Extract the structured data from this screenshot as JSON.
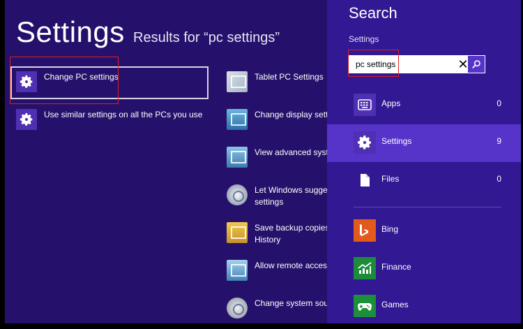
{
  "left": {
    "title": "Settings",
    "results_for": "Results for “pc settings”",
    "settings_results": [
      {
        "label": "Change PC settings",
        "icon": "gear-icon"
      },
      {
        "label": "Use similar settings on all the PCs you use",
        "icon": "gear-icon"
      }
    ],
    "control_panel_results": [
      {
        "label": "Tablet PC Settings",
        "icon": "tablet-pc-icon"
      },
      {
        "label": "Change display sett",
        "icon": "display-icon"
      },
      {
        "label": "View advanced syste",
        "icon": "advanced-system-icon"
      },
      {
        "label": "Let Windows sugge",
        "label2": "settings",
        "icon": "ease-of-access-icon"
      },
      {
        "label": "Save backup copies",
        "label2": "History",
        "icon": "file-history-icon"
      },
      {
        "label": "Allow remote access",
        "icon": "remote-access-icon"
      },
      {
        "label": "Change system sour",
        "icon": "sound-icon"
      }
    ]
  },
  "search_pane": {
    "title": "Search",
    "scope": "Settings",
    "query": "pc settings",
    "clear_glyph": "✕",
    "categories": [
      {
        "name": "Apps",
        "count": "0",
        "icon": "apps-icon"
      },
      {
        "name": "Settings",
        "count": "9",
        "icon": "gear-icon",
        "active": true
      },
      {
        "name": "Files",
        "count": "0",
        "icon": "file-icon"
      }
    ],
    "apps": [
      {
        "name": "Bing",
        "icon": "bing-icon",
        "color": "#e35a1d"
      },
      {
        "name": "Finance",
        "icon": "finance-icon",
        "color": "#1c8c3b"
      },
      {
        "name": "Games",
        "icon": "games-icon",
        "color": "#1b8f3a"
      }
    ]
  },
  "colors": {
    "background": "#25116b",
    "pane": "#321893",
    "accent": "#5634c9",
    "highlight": "#e0201c"
  }
}
